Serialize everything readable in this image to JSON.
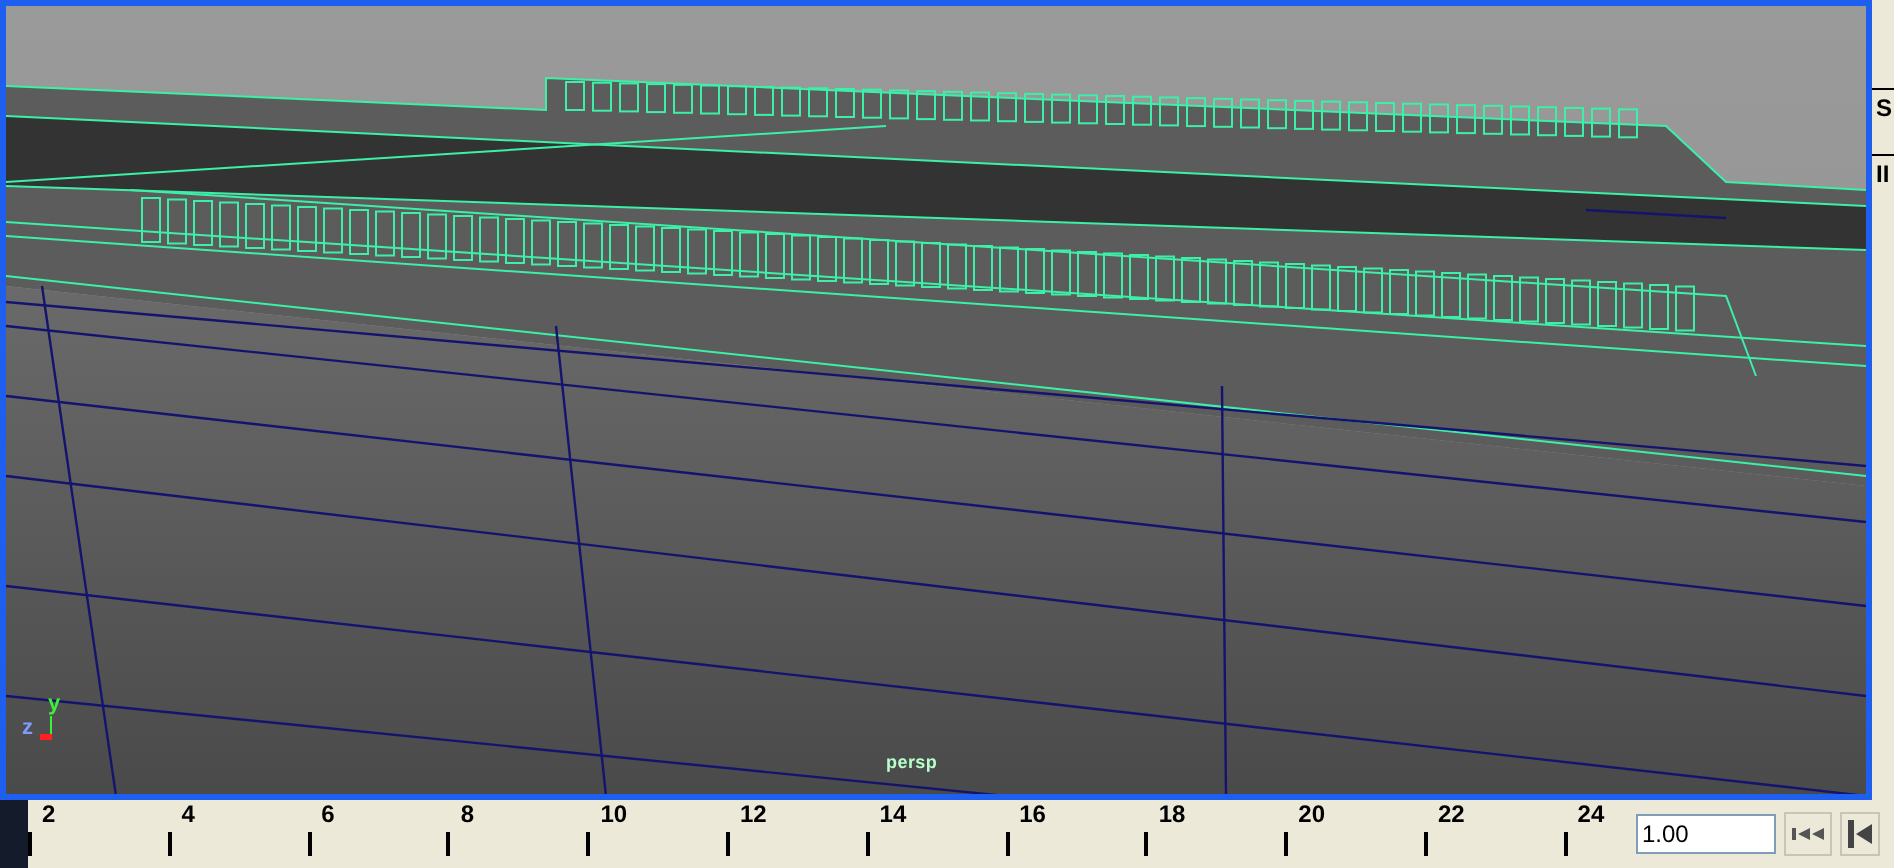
{
  "viewport": {
    "camera_label": "persp",
    "axis_labels": [
      "y",
      "z"
    ]
  },
  "side_panel": {
    "texts": [
      "S",
      "II"
    ]
  },
  "timeline": {
    "ticks": [
      "2",
      "4",
      "6",
      "8",
      "10",
      "12",
      "14",
      "16",
      "18",
      "20",
      "22",
      "24"
    ]
  },
  "current_frame": {
    "value": "1.00"
  }
}
